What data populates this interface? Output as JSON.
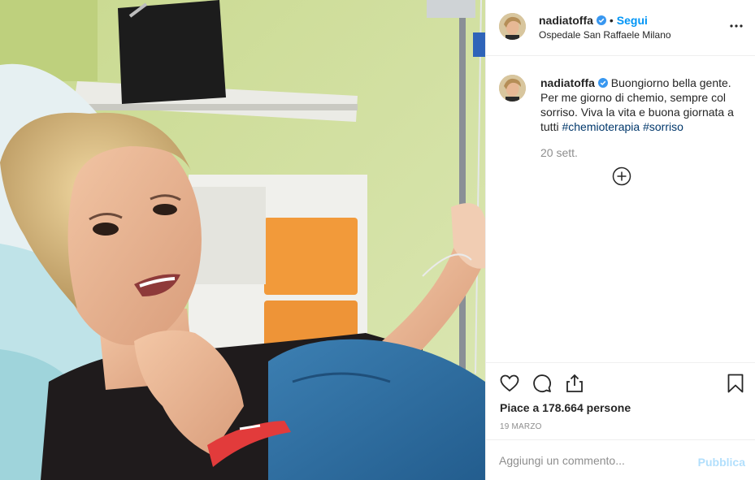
{
  "header": {
    "username": "nadiatoffa",
    "separator": "•",
    "follow_label": "Segui",
    "location": "Ospedale San Raffaele Milano"
  },
  "caption": {
    "username": "nadiatoffa",
    "text": "Buongiorno bella gente. Per me giorno di chemio, sempre col sorriso. Viva la vita e buona giornata a tutti ",
    "hashtags": [
      "#chemioterapia",
      "#sorriso"
    ],
    "time": "20 sett."
  },
  "actions": {
    "likes": "Piace a 178.664 persone",
    "date": "19 MARZO"
  },
  "comment_box": {
    "placeholder": "Aggiungi un commento...",
    "publish_label": "Pubblica"
  },
  "icons": {
    "more": "more-options-icon",
    "verified": "verified-badge-icon",
    "load_more": "plus-circle-icon",
    "like": "heart-icon",
    "comment": "comment-bubble-icon",
    "share": "share-icon",
    "save": "bookmark-icon"
  },
  "colors": {
    "link_blue": "#0095f6",
    "hashtag": "#00376b",
    "secondary_text": "#8e8e8e",
    "publish_disabled": "#b2dffc"
  }
}
